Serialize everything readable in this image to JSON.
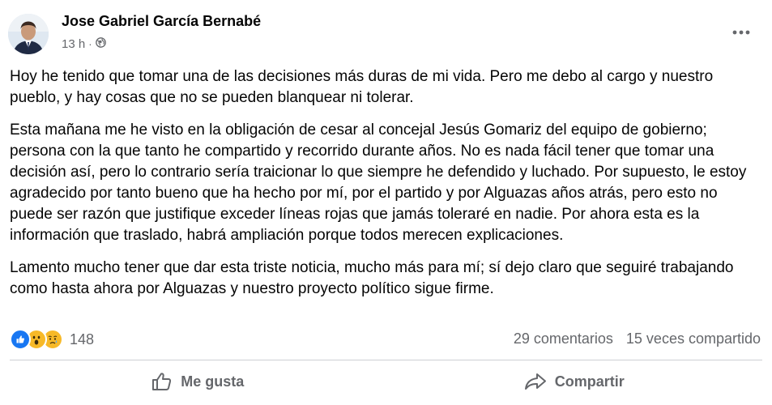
{
  "post": {
    "author": "Jose Gabriel García Bernabé",
    "time": "13 h",
    "separator": "·",
    "audience_icon": "globe-icon",
    "more_icon": "more-options-icon",
    "paragraphs": [
      "Hoy he tenido que tomar una de las decisiones más duras de mi vida. Pero me debo al cargo y nuestro pueblo, y hay cosas que no se pueden blanquear ni tolerar.",
      "Esta mañana me he visto en la obligación de cesar al concejal Jesús Gomariz del equipo de gobierno; persona con la que tanto he compartido y recorrido durante años. No es nada fácil tener que tomar una decisión así, pero lo contrario sería traicionar lo que siempre he defendido y luchado. Por supuesto, le estoy agradecido por tanto bueno que ha hecho por mí, por el partido y por Alguazas años atrás, pero esto no puede ser razón que justifique exceder líneas rojas que jamás toleraré en nadie. Por ahora esta es la información que traslado, habrá ampliación porque todos merecen explicaciones.",
      "Lamento mucho tener que dar esta triste noticia, mucho más para mí; sí dejo claro que seguiré trabajando como hasta ahora por Alguazas y nuestro proyecto político sigue firme."
    ]
  },
  "reactions": {
    "icons": [
      "like-icon",
      "wow-icon",
      "sad-icon"
    ],
    "count": "148",
    "comments": "29 comentarios",
    "shares": "15 veces compartido"
  },
  "actions": {
    "like_label": "Me gusta",
    "share_label": "Compartir"
  },
  "colors": {
    "like_blue": "#1877f2",
    "reaction_yellow": "#f7b928",
    "secondary_text": "#65676b"
  }
}
